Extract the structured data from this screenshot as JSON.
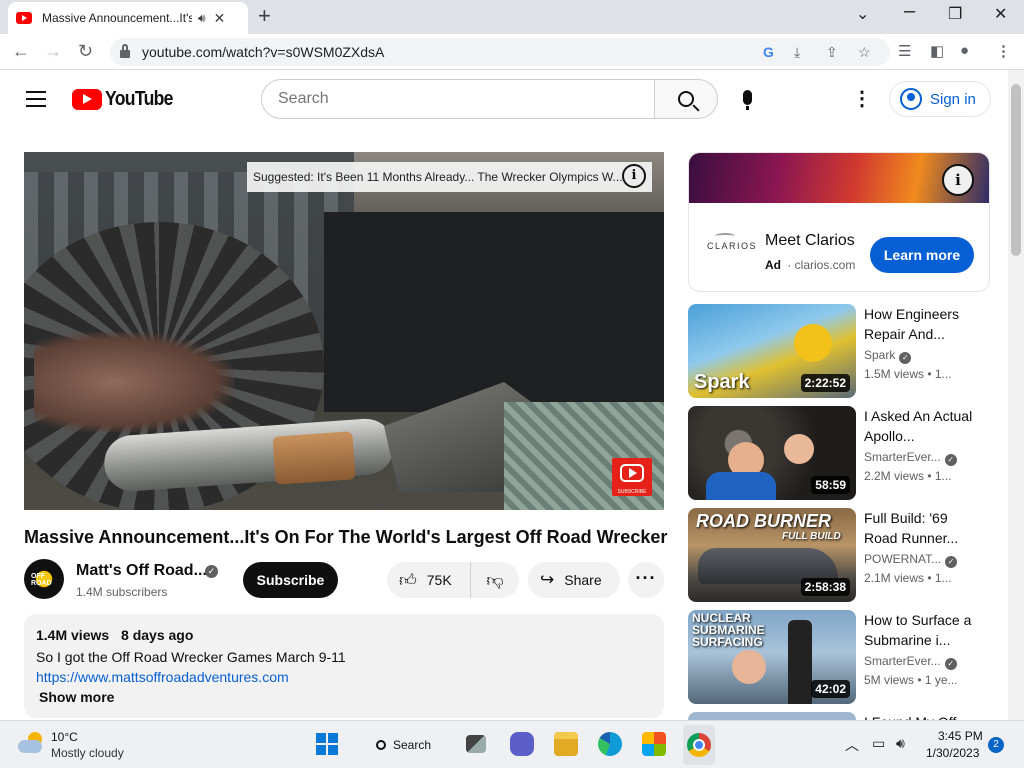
{
  "browser": {
    "tab_title": "Massive Announcement...It's",
    "url": "youtube.com/watch?v=s0WSM0ZXdsA",
    "new_tab": "+",
    "minimize": "⌄",
    "restore": "❐",
    "close": "✕"
  },
  "header": {
    "logo_text": "YouTube",
    "search_placeholder": "Search",
    "sign_in": "Sign in"
  },
  "player": {
    "suggestion": "Suggested: It's Been 11 Months Already... The Wrecker Olympics W...",
    "info": "i",
    "watermark": "SUBSCRIBE"
  },
  "video": {
    "title": "Massive Announcement...It's On For The World's Largest Off Road Wrecker",
    "channel": "Matt's Off Road...",
    "subscribers": "1.4M subscribers",
    "subscribe": "Subscribe",
    "likes": "75K",
    "share": "Share"
  },
  "description": {
    "views": "1.4M views",
    "age": "8 days ago",
    "text": "So I got the Off Road Wrecker Games March 9-11",
    "link": "https://www.mattsoffroadadventures.com",
    "show_more": "Show more"
  },
  "ad": {
    "logo": "CLARIOS",
    "title": "Meet Clarios",
    "label": "Ad",
    "domain": "clarios.com",
    "cta": "Learn more",
    "info": "i"
  },
  "recommendations": [
    {
      "title": "How Engineers Repair And...",
      "channel": "Spark",
      "meta": "1.5M views  • 1...",
      "duration": "2:22:52",
      "overlay": "Spark"
    },
    {
      "title": "I Asked An Actual Apollo...",
      "channel": "SmarterEver...",
      "meta": "2.2M views  • 1...",
      "duration": "58:59",
      "overlay": ""
    },
    {
      "title": "Full Build: '69 Road Runner...",
      "channel": "POWERNAT...",
      "meta": "2.1M views  • 1...",
      "duration": "2:58:38",
      "overlay": "ROAD BURNER",
      "overlay2": "FULL BUILD"
    },
    {
      "title": "How to Surface a Submarine i...",
      "channel": "SmarterEver...",
      "meta": "5M views  • 1 ye...",
      "duration": "42:02",
      "overlay": "NUCLEAR SUBMARINE SURFACING"
    },
    {
      "title": "I Found My Off...",
      "channel": "",
      "meta": "",
      "duration": "",
      "overlay": ""
    }
  ],
  "taskbar": {
    "temperature": "10°C",
    "weather": "Mostly cloudy",
    "search": "Search",
    "time": "3:45 PM",
    "date": "1/30/2023",
    "notifications": "2"
  }
}
